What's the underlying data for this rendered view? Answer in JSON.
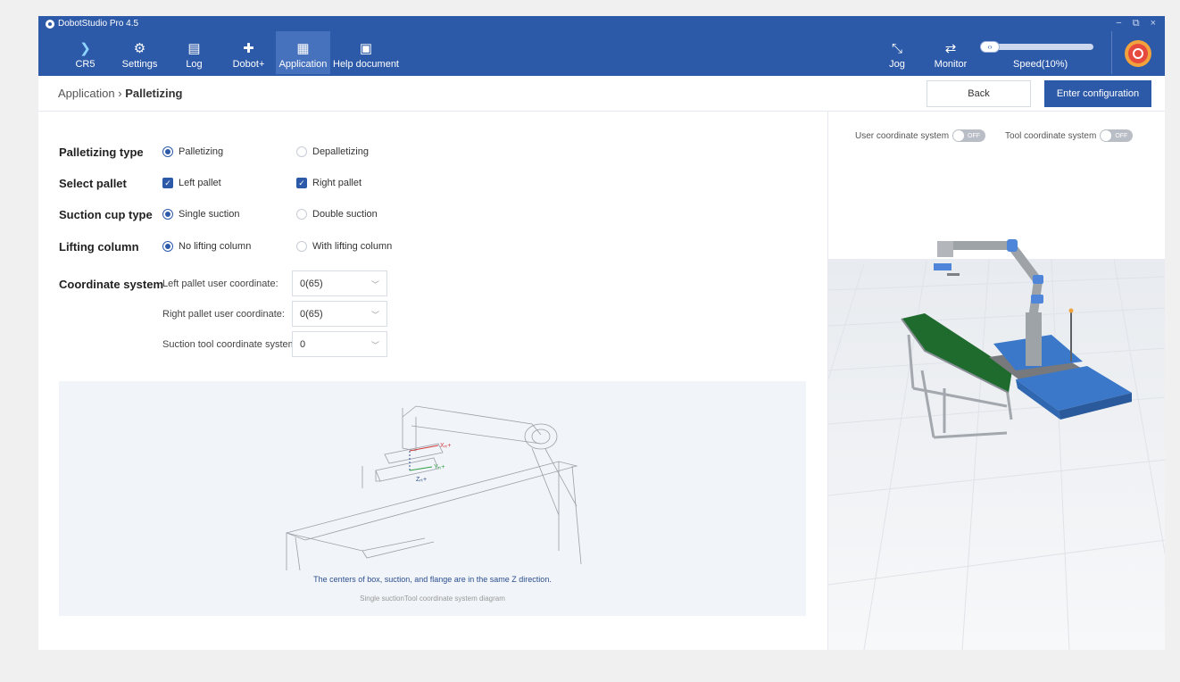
{
  "window": {
    "title": "DobotStudio Pro 4.5",
    "controls": [
      "−",
      "⧉",
      "×"
    ]
  },
  "nav": [
    {
      "label": "CR5",
      "icon": "robot-arm-icon",
      "glyph": "❯"
    },
    {
      "label": "Settings",
      "icon": "gear-icon",
      "glyph": "⚙"
    },
    {
      "label": "Log",
      "icon": "log-icon",
      "glyph": "▤"
    },
    {
      "label": "Dobot+",
      "icon": "puzzle-icon",
      "glyph": "✚"
    },
    {
      "label": "Application",
      "icon": "application-icon",
      "glyph": "▦"
    },
    {
      "label": "Help document",
      "icon": "help-icon",
      "glyph": "▣"
    }
  ],
  "right_nav": {
    "jog": {
      "label": "Jog",
      "glyph": "⤡"
    },
    "monitor": {
      "label": "Monitor",
      "glyph": "⇄"
    },
    "speed": {
      "label": "Speed(10%)",
      "value_percent": 10,
      "knob": "‹›"
    }
  },
  "breadcrumb": {
    "parent": "Application",
    "separator": "›",
    "current": "Palletizing"
  },
  "buttons": {
    "back": "Back",
    "enter": "Enter configuration"
  },
  "form": {
    "palletizing_type": {
      "label": "Palletizing type",
      "options": [
        "Palletizing",
        "Depalletizing"
      ],
      "selected": 0
    },
    "select_pallet": {
      "label": "Select pallet",
      "options": [
        "Left pallet",
        "Right pallet"
      ],
      "checked": [
        true,
        true
      ]
    },
    "suction_cup_type": {
      "label": "Suction cup type",
      "options": [
        "Single suction",
        "Double suction"
      ],
      "selected": 0
    },
    "lifting_column": {
      "label": "Lifting column",
      "options": [
        "No lifting column",
        "With lifting column"
      ],
      "selected": 0
    },
    "coordinate_system": {
      "label": "Coordinate system",
      "fields": [
        {
          "label": "Left pallet user coordinate:",
          "value": "0(65)"
        },
        {
          "label": "Right pallet user coordinate:",
          "value": "0(65)"
        },
        {
          "label": "Suction tool coordinate system:",
          "value": "0"
        }
      ]
    }
  },
  "diagram": {
    "caption": "The centers of box, suction, and flange are in the same Z direction.",
    "subcaption": "Single suctionTool coordinate system diagram",
    "axis_labels": {
      "x": "Xᵣₜ+",
      "y": "Yᵣₜ+",
      "z": "Zᵣₜ+"
    }
  },
  "scene": {
    "user_coordinate_label": "User coordinate system",
    "tool_coordinate_label": "Tool coordinate system",
    "toggle_off_text": "OFF"
  },
  "colors": {
    "header": "#2d5aa8",
    "accent": "#2d5aa8",
    "conveyor": "#1f6b2e",
    "pallet": "#3b78c9"
  }
}
